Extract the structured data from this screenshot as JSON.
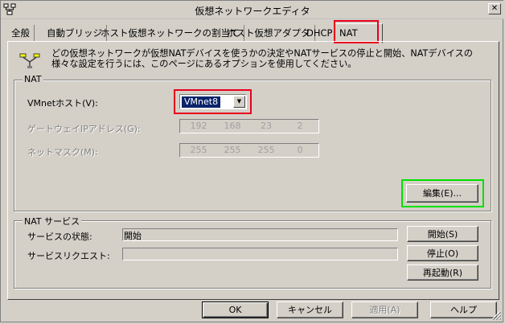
{
  "window": {
    "title": "仮想ネットワークエディタ",
    "close_glyph": "✕"
  },
  "tabs": [
    {
      "label": "全般"
    },
    {
      "label": "自動ブリッジ"
    },
    {
      "label": "ホスト仮想ネットワークの割当て"
    },
    {
      "label": "ホスト仮想アダプタ"
    },
    {
      "label": "DHCP"
    },
    {
      "label": "NAT"
    }
  ],
  "description": "どの仮想ネットワークが仮想NATデバイスを使うかの決定やNATサービスの停止と開始、NATデバイスの様々な設定を行うには、このページにあるオプションを使用してください。",
  "nat_group": {
    "title": "NAT",
    "vmnet_host_label": "VMnetホスト(V):",
    "vmnet_host_value": "VMnet8",
    "gateway_label": "ゲートウェイIPアドレス(G):",
    "gateway_octets": [
      "192",
      "168",
      "23",
      "2"
    ],
    "netmask_label": "ネットマスク(M):",
    "netmask_octets": [
      "255",
      "255",
      "255",
      "0"
    ],
    "edit_button": "編集(E)..."
  },
  "service_group": {
    "title": "NAT サービス",
    "status_label": "サービスの状態:",
    "status_value": "開始",
    "request_label": "サービスリクエスト:",
    "request_value": "",
    "start_button": "開始(S)",
    "stop_button": "停止(O)",
    "restart_button": "再起動(R)"
  },
  "footer": {
    "ok": "OK",
    "cancel": "キャンセル",
    "apply": "適用(A)",
    "help": "ヘルプ"
  },
  "colors": {
    "face": "#d4d0c8",
    "highlight": "#e8001c",
    "focus": "#00e000",
    "selection": "#0a246a"
  }
}
